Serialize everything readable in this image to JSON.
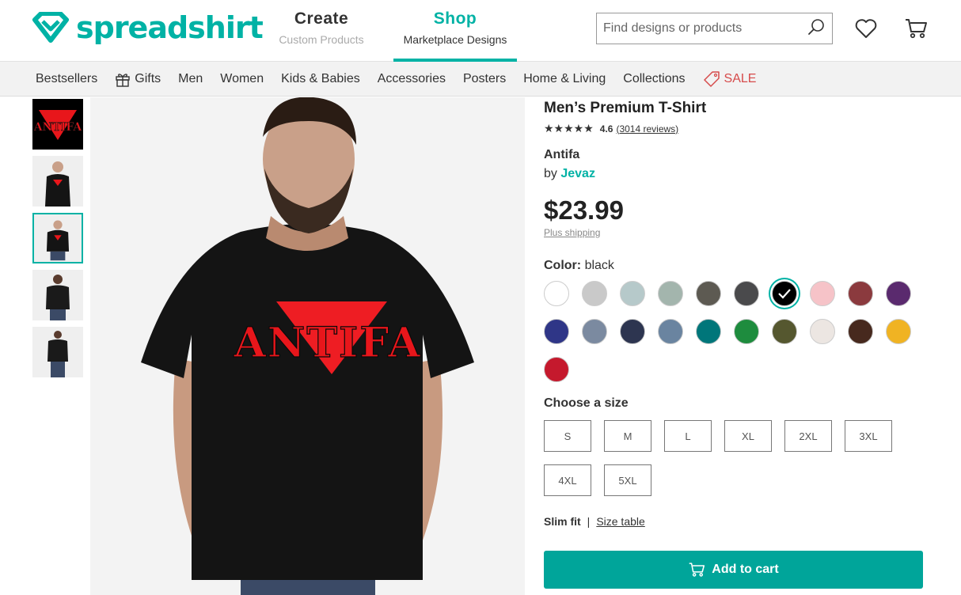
{
  "header": {
    "logo_text": "spreadshirt",
    "create": {
      "title": "Create",
      "subtitle": "Custom Products"
    },
    "shop": {
      "title": "Shop",
      "subtitle": "Marketplace Designs"
    },
    "search_placeholder": "Find designs or products",
    "icons": [
      "search-icon",
      "heart-icon",
      "cart-icon"
    ]
  },
  "nav": {
    "items": [
      "Bestsellers",
      "Gifts",
      "Men",
      "Women",
      "Kids & Babies",
      "Accessories",
      "Posters",
      "Home & Living",
      "Collections",
      "SALE"
    ]
  },
  "product": {
    "title": "Men’s Premium T-Shirt",
    "stars": "★★★★★",
    "rating": "4.6",
    "reviews": "(3014 reviews)",
    "design": "Antifa",
    "by_label": "by",
    "designer": "Jevaz",
    "price": "$23.99",
    "shipping": "Plus shipping",
    "color_label": "Color:",
    "color_value": "black",
    "size_label": "Choose a size",
    "sizes": [
      "S",
      "M",
      "L",
      "XL",
      "2XL",
      "3XL",
      "4XL",
      "5XL"
    ],
    "fit_label": "Slim fit",
    "fit_sep": "|",
    "size_table": "Size table",
    "add_to_cart": "Add to cart",
    "design_print": "ANTIFA"
  },
  "colors": {
    "accent": "#00b2a5",
    "sale": "#d64b4b",
    "swatches": [
      "#ffffff",
      "#c9c9c9",
      "#b6c9ca",
      "#a3b5ad",
      "#5d5a52",
      "#4a4a4c",
      "#000000",
      "#f6c3c8",
      "#8b3a3e",
      "#5a2a6e",
      "#2f3687",
      "#7b8aa0",
      "#2d3550",
      "#6a84a0",
      "#00767a",
      "#1e8c3e",
      "#55572f",
      "#ece6e2",
      "#47291e",
      "#f0b323",
      "#c5192d"
    ],
    "selected_index": 6
  }
}
